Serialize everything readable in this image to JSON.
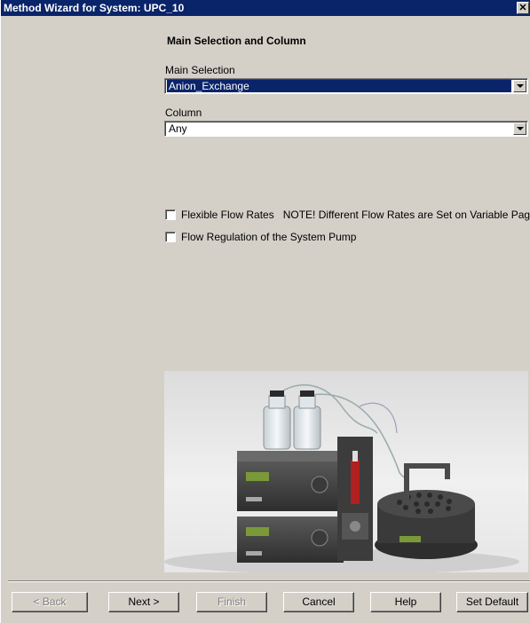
{
  "window": {
    "title": "Method Wizard for System: UPC_10",
    "close_glyph": "✕"
  },
  "page": {
    "heading": "Main Selection and Column"
  },
  "main_selection": {
    "label": "Main Selection",
    "value": "Anion_Exchange"
  },
  "column": {
    "label": "Column",
    "value": "Any"
  },
  "options": [
    {
      "label": "Flexible Flow Rates   NOTE! Different Flow Rates are Set on Variable Page",
      "checked": false
    },
    {
      "label": "Flow Regulation of the System Pump",
      "checked": false
    }
  ],
  "buttons": {
    "back": "< Back",
    "next": "Next >",
    "finish": "Finish",
    "cancel": "Cancel",
    "help": "Help",
    "set_default": "Set Default"
  },
  "colors": {
    "title_bar": "#0a246a",
    "dialog_bg": "#d4d0c8",
    "selection": "#0a246a"
  }
}
